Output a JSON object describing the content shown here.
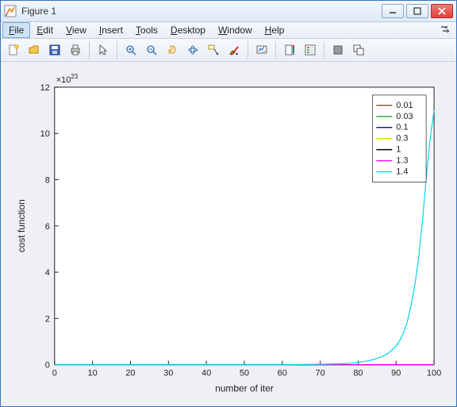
{
  "window": {
    "title": "Figure 1"
  },
  "menu": {
    "items": [
      {
        "label": "File",
        "key": "F"
      },
      {
        "label": "Edit",
        "key": "E"
      },
      {
        "label": "View",
        "key": "V"
      },
      {
        "label": "Insert",
        "key": "I"
      },
      {
        "label": "Tools",
        "key": "T"
      },
      {
        "label": "Desktop",
        "key": "D"
      },
      {
        "label": "Window",
        "key": "W"
      },
      {
        "label": "Help",
        "key": "H"
      }
    ],
    "selected": 0
  },
  "toolbar": {
    "icons": [
      "new-figure",
      "open",
      "save",
      "print",
      "sep",
      "pointer",
      "sep",
      "zoom-in",
      "zoom-out",
      "pan",
      "rotate3d",
      "data-cursor",
      "brush",
      "sep",
      "link-plot",
      "sep",
      "insert-colorbar",
      "insert-legend",
      "sep",
      "hide-plot-tools",
      "show-plot-tools"
    ]
  },
  "chart_data": {
    "type": "line",
    "title": "",
    "xlabel": "number of iter",
    "ylabel": "cost function",
    "y_exponent_label": "×10^23",
    "y_exponent": 23,
    "xlim": [
      0,
      100
    ],
    "ylim": [
      0,
      12
    ],
    "xticks": [
      0,
      10,
      20,
      30,
      40,
      50,
      60,
      70,
      80,
      90,
      100
    ],
    "yticks": [
      0,
      2,
      4,
      6,
      8,
      10,
      12
    ],
    "x": [
      0,
      10,
      20,
      30,
      40,
      50,
      60,
      65,
      70,
      75,
      78,
      80,
      82,
      84,
      86,
      88,
      90,
      91,
      92,
      93,
      94,
      95,
      96,
      97,
      98,
      99,
      100
    ],
    "series": [
      {
        "name": "0.01",
        "color": "#d62728",
        "values": [
          0,
          0,
          0,
          0,
          0,
          0,
          0,
          0,
          0,
          0,
          0,
          0,
          0,
          0,
          0,
          0,
          0,
          0,
          0,
          0,
          0,
          0,
          0,
          0,
          0,
          0,
          0
        ]
      },
      {
        "name": "0.03",
        "color": "#2ca02c",
        "values": [
          0,
          0,
          0,
          0,
          0,
          0,
          0,
          0,
          0,
          0,
          0,
          0,
          0,
          0,
          0,
          0,
          0,
          0,
          0,
          0,
          0,
          0,
          0,
          0,
          0,
          0,
          0
        ]
      },
      {
        "name": "0.1",
        "color": "#0000ff",
        "values": [
          0,
          0,
          0,
          0,
          0,
          0,
          0,
          0,
          0,
          0,
          0,
          0,
          0,
          0,
          0,
          0,
          0,
          0,
          0,
          0,
          0,
          0,
          0,
          0,
          0,
          0,
          0
        ]
      },
      {
        "name": "0.3",
        "color": "#d9d90b",
        "values": [
          0,
          0,
          0,
          0,
          0,
          0,
          0,
          0,
          0,
          0,
          0,
          0,
          0,
          0,
          0,
          0,
          0,
          0,
          0,
          0,
          0,
          0,
          0,
          0,
          0,
          0,
          0
        ]
      },
      {
        "name": "1",
        "color": "#000000",
        "values": [
          0,
          0,
          0,
          0,
          0,
          0,
          0,
          0,
          0,
          0,
          0,
          0,
          0,
          0,
          0,
          0,
          0,
          0,
          0,
          0,
          0,
          0,
          0,
          0,
          0,
          0,
          0
        ]
      },
      {
        "name": "1.3",
        "color": "#ff00ff",
        "values": [
          0,
          0,
          0,
          0,
          0,
          0,
          0,
          0,
          0,
          0,
          0,
          0,
          0,
          0,
          0,
          0,
          0,
          0,
          0,
          0,
          0,
          0,
          0,
          0,
          0,
          0,
          0
        ]
      },
      {
        "name": "1.4",
        "color": "#00d7e9",
        "values": [
          0,
          0,
          0,
          0,
          0,
          0,
          0,
          0.01,
          0.02,
          0.04,
          0.06,
          0.1,
          0.15,
          0.22,
          0.33,
          0.5,
          0.8,
          1.05,
          1.4,
          1.9,
          2.6,
          3.5,
          4.7,
          6.3,
          8.2,
          9.8,
          11
        ]
      }
    ],
    "legend": {
      "position": "northeast"
    }
  }
}
